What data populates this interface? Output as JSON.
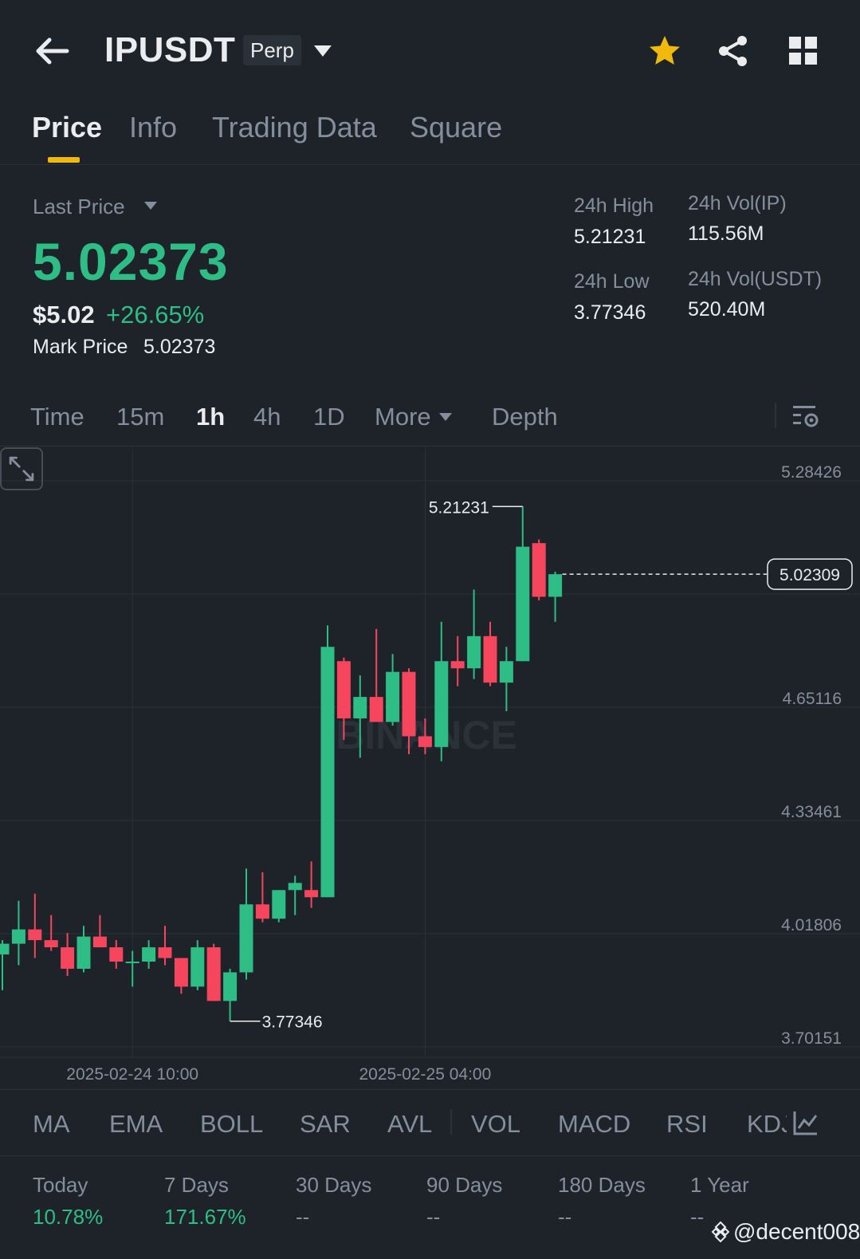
{
  "header": {
    "symbol": "IPUSDT",
    "contract_type": "Perp"
  },
  "tabs": [
    {
      "label": "Price",
      "active": true
    },
    {
      "label": "Info",
      "active": false
    },
    {
      "label": "Trading Data",
      "active": false
    },
    {
      "label": "Square",
      "active": false
    }
  ],
  "ticker": {
    "last_price_label": "Last Price",
    "last_price": "5.02373",
    "usd_price": "$5.02",
    "change_pct": "+26.65%",
    "mark_price_label": "Mark Price",
    "mark_price": "5.02373",
    "high_label": "24h High",
    "high": "5.21231",
    "low_label": "24h Low",
    "low": "3.77346",
    "vol_base_label": "24h Vol(IP)",
    "vol_base": "115.56M",
    "vol_quote_label": "24h Vol(USDT)",
    "vol_quote": "520.40M"
  },
  "intervals": [
    {
      "label": "Time",
      "active": false
    },
    {
      "label": "15m",
      "active": false
    },
    {
      "label": "1h",
      "active": true
    },
    {
      "label": "4h",
      "active": false
    },
    {
      "label": "1D",
      "active": false
    },
    {
      "label": "More",
      "active": false
    },
    {
      "label": "Depth",
      "active": false
    }
  ],
  "chart_data": {
    "type": "candlestick",
    "interval": "1h",
    "y_ticks": [
      "5.28426",
      "4.65116",
      "4.33461",
      "4.01806",
      "3.70151"
    ],
    "x_ticks": [
      "2025-02-24 10:00",
      "2025-02-25 04:00"
    ],
    "ylim": [
      3.70151,
      5.28426
    ],
    "current_price_label": "5.02309",
    "high_marker": "5.21231",
    "low_marker": "3.77346",
    "watermark": "BINANCE",
    "up_color": "#2ebd85",
    "down_color": "#f6465d",
    "candles": [
      {
        "o": 3.96,
        "h": 4.0,
        "l": 3.86,
        "c": 3.99
      },
      {
        "o": 3.99,
        "h": 4.11,
        "l": 3.93,
        "c": 4.03
      },
      {
        "o": 4.03,
        "h": 4.13,
        "l": 3.95,
        "c": 4.0
      },
      {
        "o": 4.0,
        "h": 4.07,
        "l": 3.97,
        "c": 3.98
      },
      {
        "o": 3.98,
        "h": 4.02,
        "l": 3.9,
        "c": 3.92
      },
      {
        "o": 3.92,
        "h": 4.04,
        "l": 3.91,
        "c": 4.01
      },
      {
        "o": 4.01,
        "h": 4.07,
        "l": 3.98,
        "c": 3.98
      },
      {
        "o": 3.98,
        "h": 4.0,
        "l": 3.92,
        "c": 3.94
      },
      {
        "o": 3.94,
        "h": 3.97,
        "l": 3.87,
        "c": 3.94
      },
      {
        "o": 3.94,
        "h": 4.0,
        "l": 3.92,
        "c": 3.98
      },
      {
        "o": 3.98,
        "h": 4.04,
        "l": 3.93,
        "c": 3.95
      },
      {
        "o": 3.95,
        "h": 3.95,
        "l": 3.85,
        "c": 3.87
      },
      {
        "o": 3.87,
        "h": 4.0,
        "l": 3.86,
        "c": 3.98
      },
      {
        "o": 3.98,
        "h": 3.99,
        "l": 3.83,
        "c": 3.83
      },
      {
        "o": 3.83,
        "h": 3.92,
        "l": 3.77346,
        "c": 3.91
      },
      {
        "o": 3.91,
        "h": 4.2,
        "l": 3.89,
        "c": 4.1
      },
      {
        "o": 4.1,
        "h": 4.19,
        "l": 4.05,
        "c": 4.06
      },
      {
        "o": 4.06,
        "h": 4.14,
        "l": 4.05,
        "c": 4.14
      },
      {
        "o": 4.14,
        "h": 4.18,
        "l": 4.07,
        "c": 4.16
      },
      {
        "o": 4.14,
        "h": 4.22,
        "l": 4.09,
        "c": 4.12
      },
      {
        "o": 4.12,
        "h": 4.88,
        "l": 4.12,
        "c": 4.82
      },
      {
        "o": 4.78,
        "h": 4.79,
        "l": 4.56,
        "c": 4.62
      },
      {
        "o": 4.62,
        "h": 4.74,
        "l": 4.51,
        "c": 4.68
      },
      {
        "o": 4.68,
        "h": 4.87,
        "l": 4.64,
        "c": 4.61
      },
      {
        "o": 4.61,
        "h": 4.8,
        "l": 4.6,
        "c": 4.75
      },
      {
        "o": 4.75,
        "h": 4.76,
        "l": 4.52,
        "c": 4.57
      },
      {
        "o": 4.57,
        "h": 4.62,
        "l": 4.52,
        "c": 4.54
      },
      {
        "o": 4.54,
        "h": 4.89,
        "l": 4.5,
        "c": 4.78
      },
      {
        "o": 4.78,
        "h": 4.85,
        "l": 4.71,
        "c": 4.76
      },
      {
        "o": 4.76,
        "h": 4.98,
        "l": 4.73,
        "c": 4.85
      },
      {
        "o": 4.85,
        "h": 4.89,
        "l": 4.71,
        "c": 4.72
      },
      {
        "o": 4.72,
        "h": 4.82,
        "l": 4.64,
        "c": 4.78
      },
      {
        "o": 4.78,
        "h": 5.21231,
        "l": 4.78,
        "c": 5.1
      },
      {
        "o": 5.11,
        "h": 5.12,
        "l": 4.95,
        "c": 4.96
      },
      {
        "o": 4.96,
        "h": 5.03,
        "l": 4.89,
        "c": 5.02309
      }
    ]
  },
  "indicators": [
    "MA",
    "EMA",
    "BOLL",
    "SAR",
    "AVL",
    "VOL",
    "MACD",
    "RSI",
    "KDJ"
  ],
  "performance": [
    {
      "label": "Today",
      "value": "10.78%",
      "positive": true
    },
    {
      "label": "7 Days",
      "value": "171.67%",
      "positive": true
    },
    {
      "label": "30 Days",
      "value": "--",
      "positive": false
    },
    {
      "label": "90 Days",
      "value": "--",
      "positive": false
    },
    {
      "label": "180 Days",
      "value": "--",
      "positive": false
    },
    {
      "label": "1 Year",
      "value": "--",
      "positive": false
    }
  ],
  "watermark_user": "@decent008",
  "colors": {
    "background": "#1e2329",
    "accent": "#f0b90b",
    "up": "#2ebd85",
    "down": "#f6465d",
    "muted": "#848e9c"
  }
}
